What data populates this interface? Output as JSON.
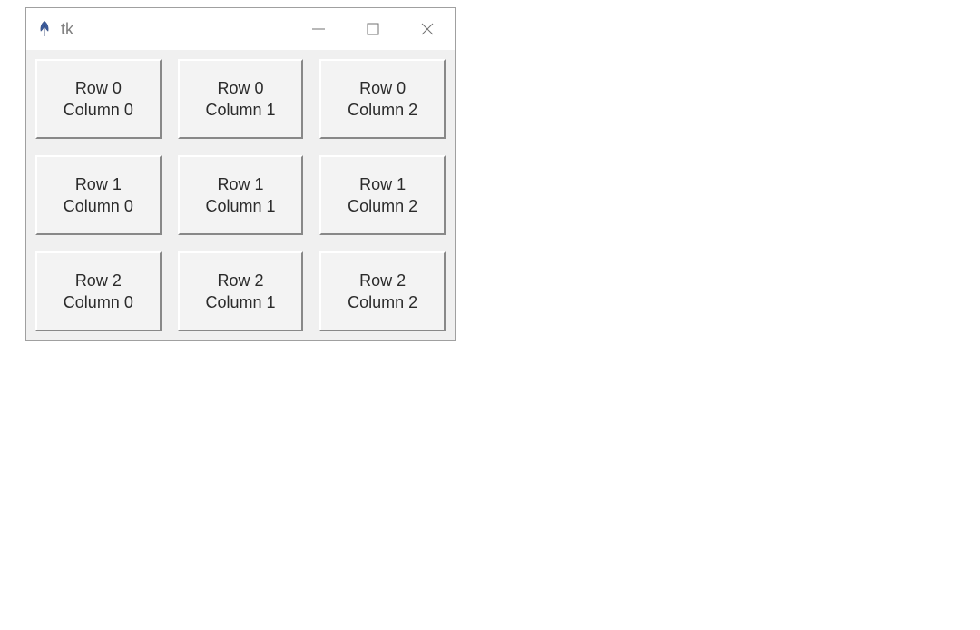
{
  "window": {
    "title": "tk",
    "icon_name": "feather-icon"
  },
  "grid": {
    "rows": [
      [
        {
          "line1": "Row 0",
          "line2": "Column 0"
        },
        {
          "line1": "Row 0",
          "line2": "Column 1"
        },
        {
          "line1": "Row 0",
          "line2": "Column 2"
        }
      ],
      [
        {
          "line1": "Row 1",
          "line2": "Column 0"
        },
        {
          "line1": "Row 1",
          "line2": "Column 1"
        },
        {
          "line1": "Row 1",
          "line2": "Column 2"
        }
      ],
      [
        {
          "line1": "Row 2",
          "line2": "Column 0"
        },
        {
          "line1": "Row 2",
          "line2": "Column 1"
        },
        {
          "line1": "Row 2",
          "line2": "Column 2"
        }
      ]
    ]
  }
}
